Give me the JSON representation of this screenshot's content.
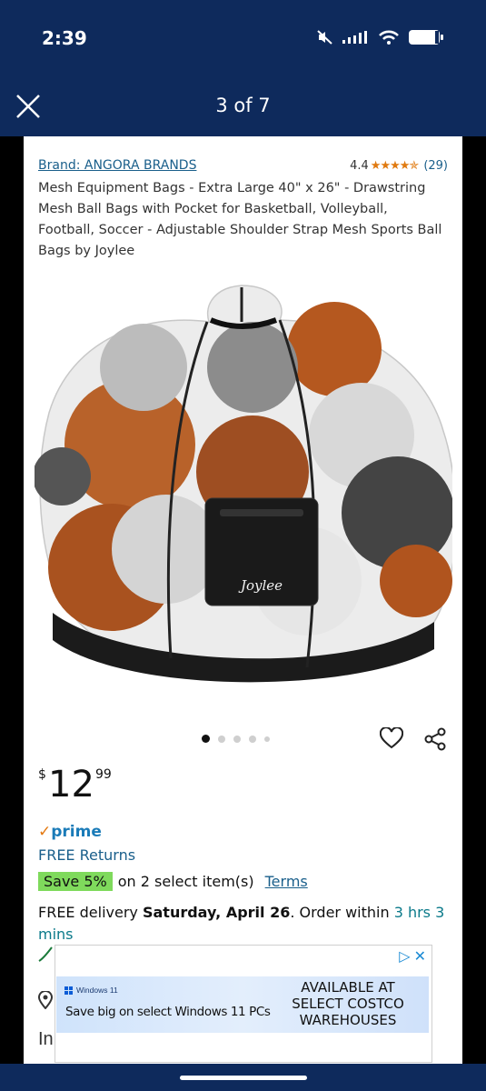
{
  "status_bar": {
    "time": "2:39"
  },
  "viewer": {
    "counter": "3 of 7"
  },
  "product": {
    "brand": "Brand: ANGORA BRANDS",
    "rating_value": "4.4",
    "rating_stars": "★★★★✯",
    "rating_count": "(29)",
    "title": "Mesh Equipment Bags - Extra Large 40\" x 26\" - Drawstring Mesh Ball Bags with Pocket for Basketball, Volleyball, Football, Soccer - Adjustable Shoulder Strap Mesh Sports Ball Bags by Joylee",
    "image_logo_text": "Joylee",
    "carousel": {
      "active_index": 0,
      "count": 5
    },
    "price": {
      "currency": "$",
      "whole": "12",
      "cents": "99"
    },
    "prime_check": "✓",
    "prime_label": "prime",
    "free_returns": "FREE Returns",
    "save_badge": "Save 5%",
    "save_text": "on 2 select item(s)",
    "terms_link": "Terms",
    "delivery_prefix": "FREE delivery ",
    "delivery_date": "Saturday, April 26",
    "delivery_mid": ". Order within ",
    "delivery_time": "3 hrs 3 mins",
    "partial_text": "In"
  },
  "ad": {
    "brand": "Windows 11",
    "tagline": "Save big on select Windows 11 PCs",
    "cta": "AVAILABLE AT SELECT COSTCO WAREHOUSES",
    "choices_icon": "▷",
    "close_icon": "✕"
  },
  "colors": {
    "nav_bg": "#0e2a5c",
    "link": "#1a5f8b",
    "prime": "#1a7bb8",
    "save_badge": "#7fda5c",
    "star": "#e07a10"
  }
}
